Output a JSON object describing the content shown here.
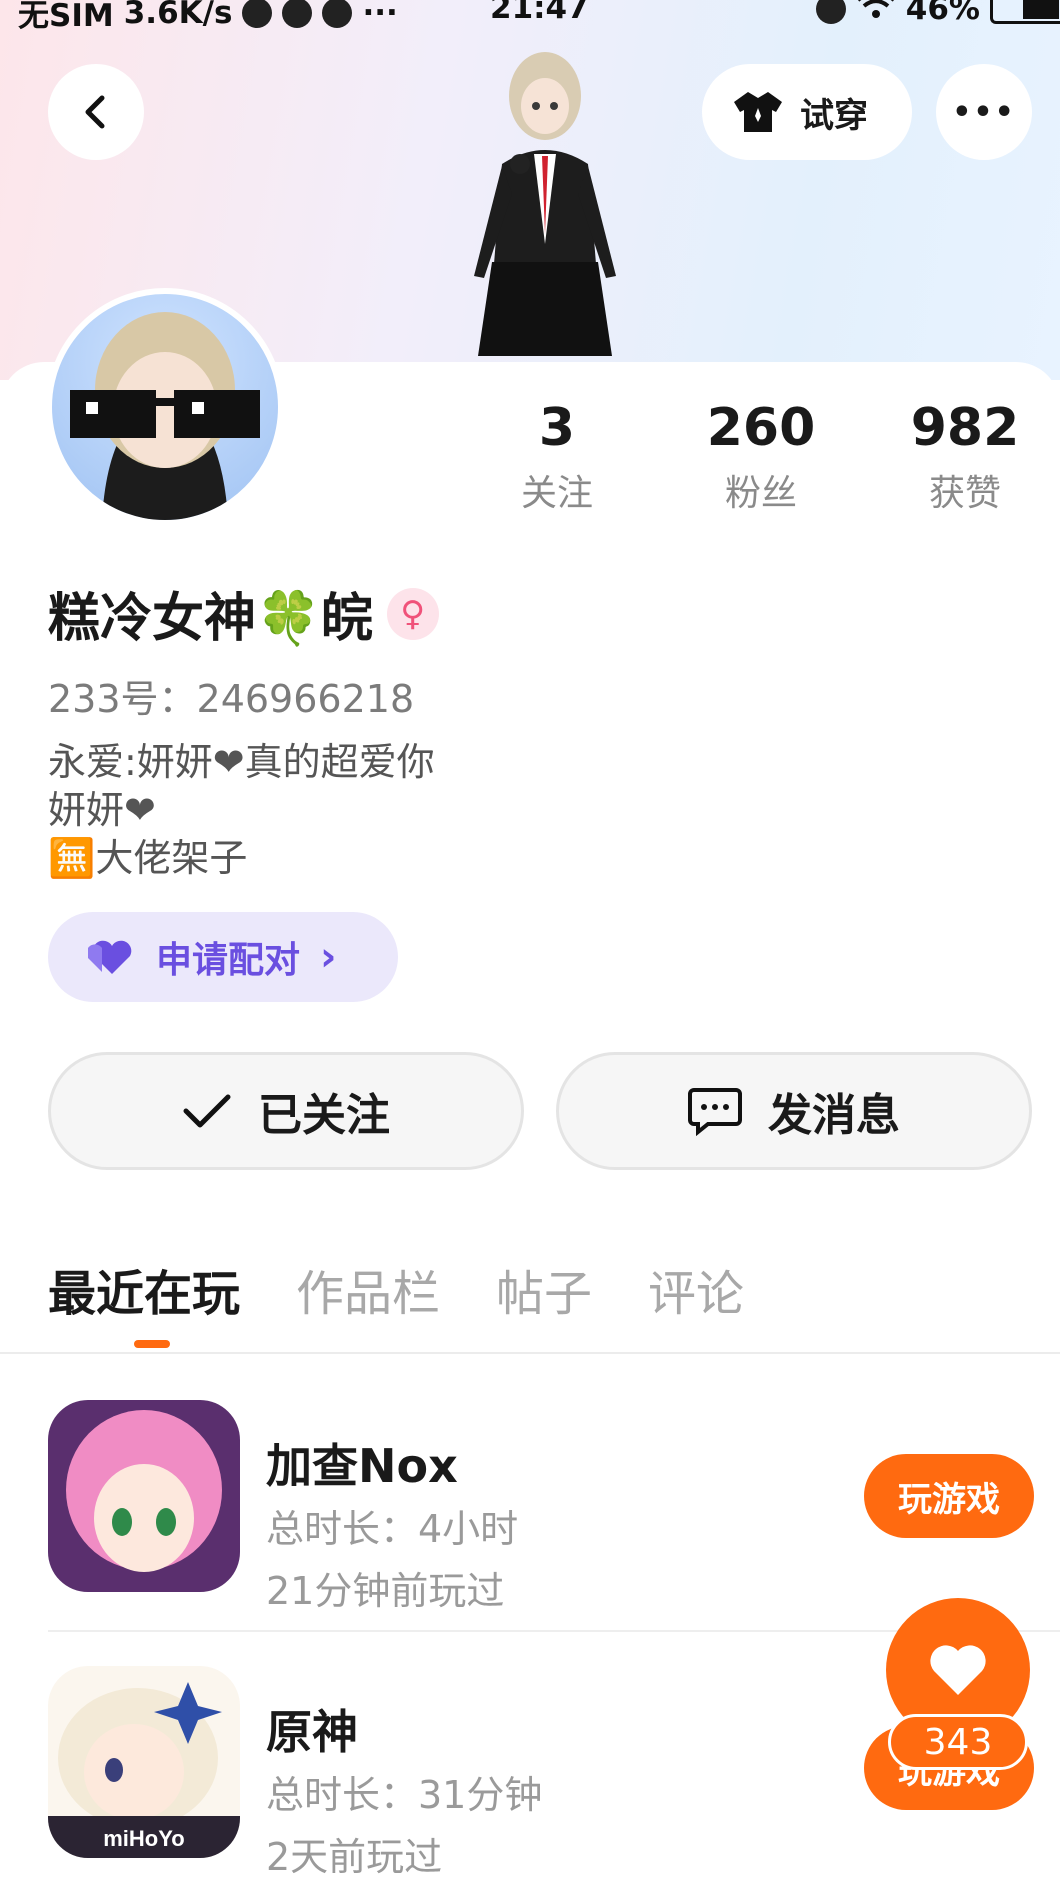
{
  "status_bar": {
    "carrier": "无SIM",
    "speed": "3.6K/s",
    "dots": "···",
    "time": "21:47",
    "battery": "46%"
  },
  "header": {
    "try_on_label": "试穿",
    "more_label": "•••"
  },
  "stats": [
    {
      "num": "3",
      "label": "关注"
    },
    {
      "num": "260",
      "label": "粉丝"
    },
    {
      "num": "982",
      "label": "获赞"
    }
  ],
  "profile": {
    "nickname": "糕冷女神🍀皖",
    "gender_symbol": "♀",
    "uid": "233号：246966218",
    "bio_line1": "永爱:妍妍❤真的超爱你",
    "bio_line2": "妍妍❤",
    "bio_line3": "🈚大佬架子"
  },
  "pair_button": {
    "label": "申请配对",
    "chevron": "›"
  },
  "actions": {
    "followed_label": "已关注",
    "message_label": "发消息"
  },
  "tabs": [
    {
      "label": "最近在玩"
    },
    {
      "label": "作品栏"
    },
    {
      "label": "帖子"
    },
    {
      "label": "评论"
    }
  ],
  "games": [
    {
      "name": "加查Nox",
      "duration": "总时长：4小时",
      "last_played": "21分钟前玩过",
      "button": "玩游戏"
    },
    {
      "name": "原神",
      "duration": "总时长：31分钟",
      "last_played": "2天前玩过",
      "button": "玩游戏",
      "icon_text": "miHoYo"
    }
  ],
  "like_fab": {
    "count": "343"
  },
  "colors": {
    "accent": "#ff6a10",
    "pair_bg": "#ebe8fb",
    "pair_text": "#6a4fe0"
  }
}
